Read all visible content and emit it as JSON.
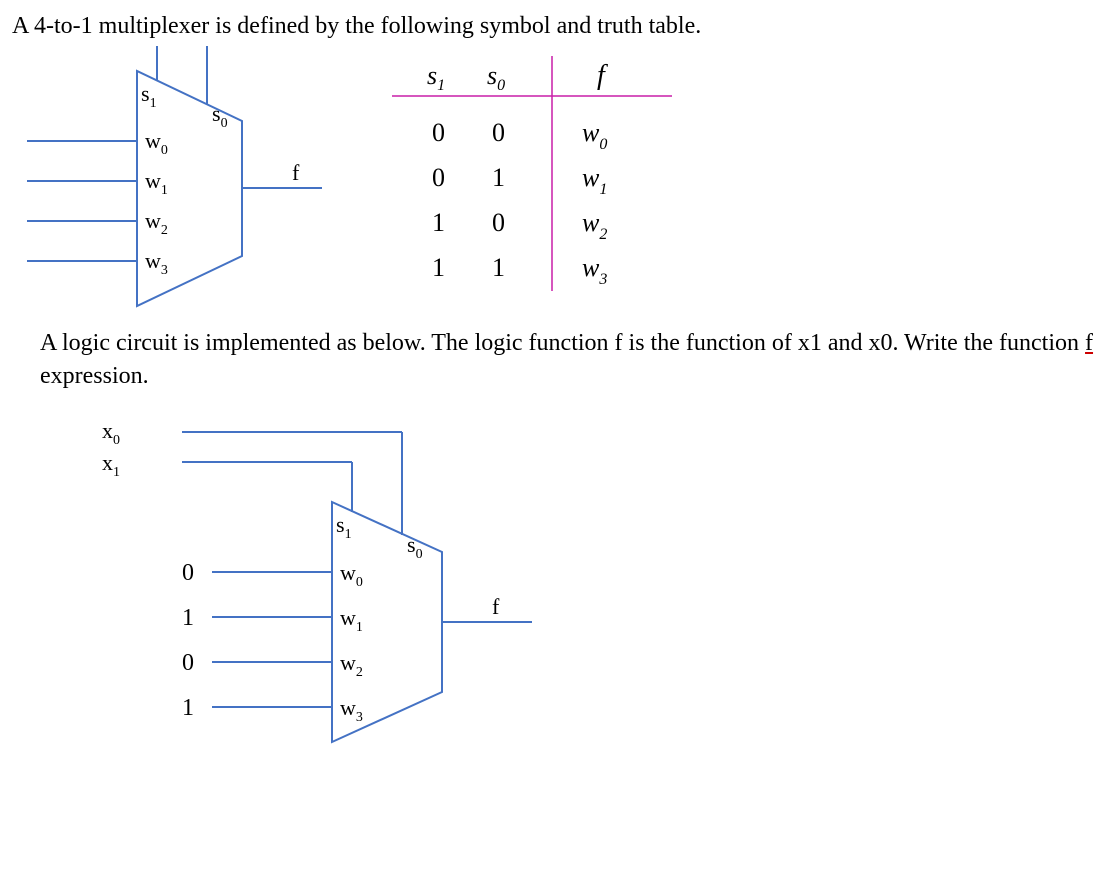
{
  "intro": "A 4-to-1 multiplexer is defined by the following symbol and truth table.",
  "symbol": {
    "sel1": "s",
    "sel1_sub": "1",
    "sel0": "s",
    "sel0_sub": "0",
    "d0": "w",
    "d0_sub": "0",
    "d1": "w",
    "d1_sub": "1",
    "d2": "w",
    "d2_sub": "2",
    "d3": "w",
    "d3_sub": "3",
    "out": "f"
  },
  "truth_table": {
    "headers": {
      "s1": "s",
      "s1_sub": "1",
      "s0": "s",
      "s0_sub": "0",
      "f": "f"
    },
    "rows": [
      {
        "s1": "0",
        "s0": "0",
        "f": "w",
        "f_sub": "0"
      },
      {
        "s1": "0",
        "s0": "1",
        "f": "w",
        "f_sub": "1"
      },
      {
        "s1": "1",
        "s0": "0",
        "f": "w",
        "f_sub": "2"
      },
      {
        "s1": "1",
        "s0": "1",
        "f": "w",
        "f_sub": "3"
      }
    ]
  },
  "para2a": "A logic circuit is implemented as below. The logic function f is the function of x1 and x0. Write the function ",
  "para2b": "f",
  "para2c": " expression.",
  "impl": {
    "x0": "x",
    "x0_sub": "0",
    "x1": "x",
    "x1_sub": "1",
    "d0_const": "0",
    "d1_const": "1",
    "d2_const": "0",
    "d3_const": "1",
    "s1": "s",
    "s1_s": "1",
    "s0": "s",
    "s0_s": "0",
    "w0": "w",
    "w0_s": "0",
    "w1": "w",
    "w1_s": "1",
    "w2": "w",
    "w2_s": "2",
    "w3": "w",
    "w3_s": "3",
    "out": "f"
  }
}
